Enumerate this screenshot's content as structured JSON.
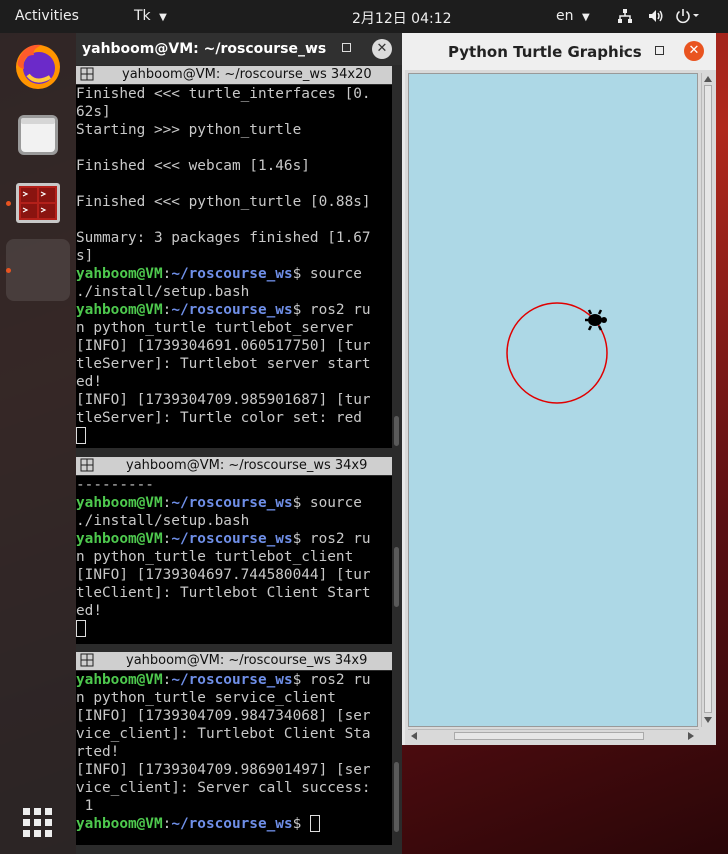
{
  "topbar": {
    "activities": "Activities",
    "app_menu": "Tk",
    "clock": "2月12日  04:12",
    "lang": "en"
  },
  "dock": {
    "apps": [
      {
        "name": "Firefox"
      },
      {
        "name": "Files"
      },
      {
        "name": "Terminal"
      }
    ]
  },
  "terminal": {
    "title": "yahboom@VM: ~/roscourse_ws",
    "panes": [
      {
        "header": "yahboom@VM: ~/roscourse_ws 34x20",
        "lines": [
          [
            {
              "t": "Finished <<< turtle_interfaces [0."
            }
          ],
          [
            {
              "t": "62s]"
            }
          ],
          [
            {
              "t": "Starting >>> python_turtle"
            }
          ],
          [
            {
              "t": ""
            }
          ],
          [
            {
              "t": "Finished <<< webcam [1.46s]"
            }
          ],
          [
            {
              "t": ""
            }
          ],
          [
            {
              "t": "Finished <<< python_turtle [0.88s]"
            }
          ],
          [
            {
              "t": ""
            }
          ],
          [
            {
              "t": "Summary: 3 packages finished [1.67"
            }
          ],
          [
            {
              "t": "s]"
            }
          ],
          [
            {
              "t": "yahboom@VM",
              "c": "pg"
            },
            {
              "t": ":"
            },
            {
              "t": "~/roscourse_ws",
              "c": "pb"
            },
            {
              "t": "$ source"
            }
          ],
          [
            {
              "t": "./install/setup.bash"
            }
          ],
          [
            {
              "t": "yahboom@VM",
              "c": "pg"
            },
            {
              "t": ":"
            },
            {
              "t": "~/roscourse_ws",
              "c": "pb"
            },
            {
              "t": "$ ros2 ru"
            }
          ],
          [
            {
              "t": "n python_turtle turtlebot_server"
            }
          ],
          [
            {
              "t": "[INFO] [1739304691.060517750] [tur"
            }
          ],
          [
            {
              "t": "tleServer]: Turtlebot server start"
            }
          ],
          [
            {
              "t": "ed!"
            }
          ],
          [
            {
              "t": "[INFO] [1739304709.985901687] [tur"
            }
          ],
          [
            {
              "t": "tleServer]: Turtle color set: red"
            }
          ],
          [
            {
              "t": "",
              "cursor": true
            }
          ]
        ]
      },
      {
        "header": "yahboom@VM: ~/roscourse_ws 34x9",
        "lines": [
          [
            {
              "t": "---------"
            }
          ],
          [
            {
              "t": "yahboom@VM",
              "c": "pg"
            },
            {
              "t": ":"
            },
            {
              "t": "~/roscourse_ws",
              "c": "pb"
            },
            {
              "t": "$ source"
            }
          ],
          [
            {
              "t": "./install/setup.bash"
            }
          ],
          [
            {
              "t": "yahboom@VM",
              "c": "pg"
            },
            {
              "t": ":"
            },
            {
              "t": "~/roscourse_ws",
              "c": "pb"
            },
            {
              "t": "$ ros2 ru"
            }
          ],
          [
            {
              "t": "n python_turtle turtlebot_client"
            }
          ],
          [
            {
              "t": "[INFO] [1739304697.744580044] [tur"
            }
          ],
          [
            {
              "t": "tleClient]: Turtlebot Client Start"
            }
          ],
          [
            {
              "t": "ed!"
            }
          ],
          [
            {
              "t": "",
              "cursor": true
            }
          ]
        ]
      },
      {
        "header": "yahboom@VM: ~/roscourse_ws 34x9",
        "lines": [
          [
            {
              "t": "yahboom@VM",
              "c": "pg"
            },
            {
              "t": ":"
            },
            {
              "t": "~/roscourse_ws",
              "c": "pb"
            },
            {
              "t": "$ ros2 ru"
            }
          ],
          [
            {
              "t": "n python_turtle service_client"
            }
          ],
          [
            {
              "t": "[INFO] [1739304709.984734068] [ser"
            }
          ],
          [
            {
              "t": "vice_client]: Turtlebot Client Sta"
            }
          ],
          [
            {
              "t": "rted!"
            }
          ],
          [
            {
              "t": "[INFO] [1739304709.986901497] [ser"
            }
          ],
          [
            {
              "t": "vice_client]: Server call success:"
            }
          ],
          [
            {
              "t": " 1"
            }
          ],
          [
            {
              "t": "yahboom@VM",
              "c": "pg"
            },
            {
              "t": ":"
            },
            {
              "t": "~/roscourse_ws",
              "c": "pb"
            },
            {
              "t": "$ ",
              "cursor_after": true
            }
          ]
        ]
      }
    ]
  },
  "turtle_window": {
    "title": "Python Turtle Graphics",
    "pen_color": "#e00000",
    "canvas_color": "#add8e6"
  },
  "colors": {
    "prompt_green": "#4ec94e",
    "prompt_blue": "#6f8fe8",
    "close_button": "#e95420"
  }
}
